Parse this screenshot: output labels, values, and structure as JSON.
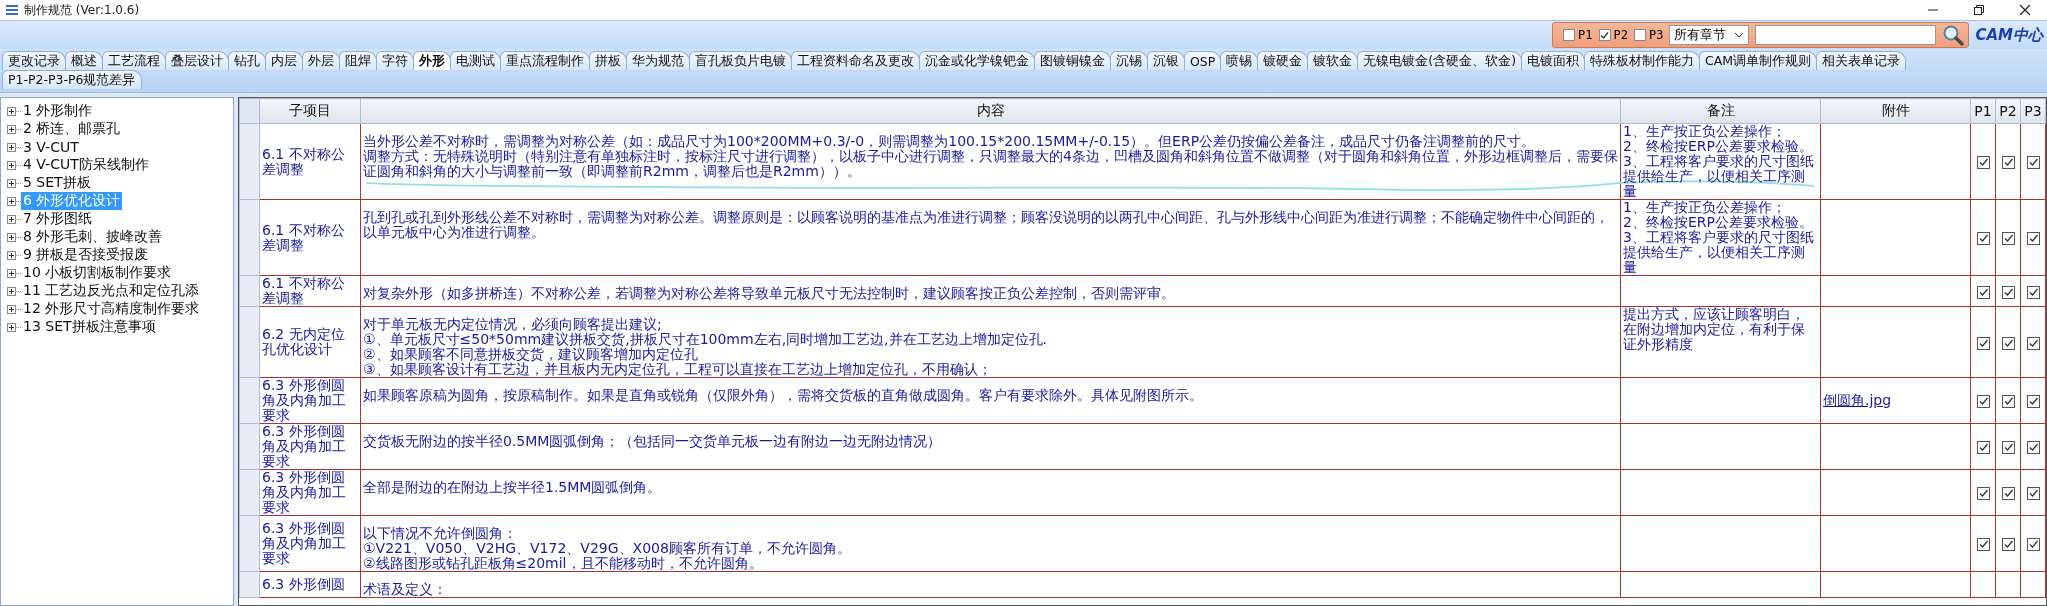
{
  "window": {
    "title": "制作规范 (Ver:1.0.6)"
  },
  "filter": {
    "options": [
      {
        "label": "P1",
        "checked": false
      },
      {
        "label": "P2",
        "checked": true
      },
      {
        "label": "P3",
        "checked": false
      }
    ],
    "chapter": "所有章节",
    "logo": "CAM中心"
  },
  "tab_rows": [
    [
      {
        "label": "更改记录",
        "selected": false
      },
      {
        "label": "概述",
        "selected": false
      },
      {
        "label": "工艺流程",
        "selected": false
      },
      {
        "label": "叠层设计",
        "selected": false
      },
      {
        "label": "钻孔",
        "selected": false
      },
      {
        "label": "内层",
        "selected": false
      },
      {
        "label": "外层",
        "selected": false
      },
      {
        "label": "阻焊",
        "selected": false
      },
      {
        "label": "字符",
        "selected": false
      },
      {
        "label": "外形",
        "selected": true
      },
      {
        "label": "电测试",
        "selected": false
      },
      {
        "label": "重点流程制作",
        "selected": false
      },
      {
        "label": "拼板",
        "selected": false
      },
      {
        "label": "华为规范",
        "selected": false
      },
      {
        "label": "盲孔板负片电镀",
        "selected": false
      },
      {
        "label": "工程资料命名及更改",
        "selected": false
      },
      {
        "label": "沉金或化学镍钯金",
        "selected": false
      },
      {
        "label": "图镀铜镍金",
        "selected": false
      },
      {
        "label": "沉锡",
        "selected": false
      },
      {
        "label": "沉银",
        "selected": false
      },
      {
        "label": "OSP",
        "selected": false
      },
      {
        "label": "喷锡",
        "selected": false
      },
      {
        "label": "镀硬金",
        "selected": false
      },
      {
        "label": "镀软金",
        "selected": false
      },
      {
        "label": "无镍电镀金(含硬金、软金)",
        "selected": false
      },
      {
        "label": "电镀面积",
        "selected": false
      },
      {
        "label": "特殊板材制作能力",
        "selected": false
      },
      {
        "label": "CAM调单制作规则",
        "selected": false
      },
      {
        "label": "相关表单记录",
        "selected": false
      }
    ],
    [
      {
        "label": "P1-P2-P3-P6规范差异",
        "selected": false
      }
    ]
  ],
  "tree": [
    {
      "label": "1 外形制作",
      "selected": false
    },
    {
      "label": "2 桥连、邮票孔",
      "selected": false
    },
    {
      "label": "3 V-CUT",
      "selected": false
    },
    {
      "label": "4 V-CUT防呆线制作",
      "selected": false
    },
    {
      "label": "5 SET拼板",
      "selected": false
    },
    {
      "label": "6 外形优化设计",
      "selected": true
    },
    {
      "label": "7 外形图纸",
      "selected": false
    },
    {
      "label": "8 外形毛刺、披峰改善",
      "selected": false
    },
    {
      "label": "9 拼板是否接受报废",
      "selected": false
    },
    {
      "label": "10 小板切割板制作要求",
      "selected": false
    },
    {
      "label": "11 工艺边反光点和定位孔添",
      "selected": false
    },
    {
      "label": "12 外形尺寸高精度制作要求",
      "selected": false
    },
    {
      "label": "13 SET拼板注意事项",
      "selected": false
    }
  ],
  "table": {
    "columns": [
      "子项目",
      "内容",
      "备注",
      "附件",
      "P1",
      "P2",
      "P3"
    ],
    "rows": [
      {
        "subitem": "6.1 不对称公差调整",
        "content": "当外形公差不对称时，需调整为对称公差（如：成品尺寸为100*200MM+0.3/-0，则需调整为100.15*200.15MM+/-0.15）。但ERP公差仍按偏公差备注，成品尺寸仍备注调整前的尺寸。",
        "content_2": "调整方式：无特殊说明时（特别注意有单独标注时，按标注尺寸进行调整），以板子中心进行调整，只调整最大的4条边，凹槽及圆角和斜角位置不做调整（对于圆角和斜角位置，外形边框调整后，需要保证圆角和斜角的大小与调整前一致（即调整前R2mm，调整后也是R2mm））。",
        "remark": "1、生产按正负公差操作；\n2、终检按ERP公差要求检验。\n3、工程将客户要求的尺寸图纸提供给生产，以便相关工序测量",
        "p1": true,
        "p2": true,
        "p3": true,
        "scribbled": true
      },
      {
        "subitem": "6.1 不对称公差调整",
        "content": "孔到孔或孔到外形线公差不对称时，需调整为对称公差。调整原则是：以顾客说明的基准点为准进行调整；顾客没说明的以两孔中心间距、孔与外形线中心间距为准进行调整；不能确定物件中心间距的，以单元板中心为准进行调整。",
        "remark": "1、生产按正负公差操作；\n2、终检按ERP公差要求检验。\n3、工程将客户要求的尺寸图纸提供给生产，以便相关工序测量",
        "p1": true,
        "p2": true,
        "p3": true
      },
      {
        "subitem": "6.1 不对称公差调整",
        "content": "对复杂外形（如多拼桥连）不对称公差，若调整为对称公差将导致单元板尺寸无法控制时，建议顾客按正负公差控制，否则需评审。",
        "p1": true,
        "p2": true,
        "p3": true
      },
      {
        "subitem": "6.2 无内定位孔优化设计",
        "content": "对于单元板无内定位情况，必须向顾客提出建议;\n①、单元板尺寸≤50*50mm建议拼板交货,拼板尺寸在100mm左右,同时增加工艺边,并在工艺边上增加定位孔.\n②、如果顾客不同意拼板交货，建议顾客增加内定位孔\n③、如果顾客设计有工艺边，并且板内无内定位孔，工程可以直接在工艺边上增加定位孔，不用确认；",
        "remark": "提出方式，应该让顾客明白，在附边增加内定位，有利于保证外形精度",
        "p1": true,
        "p2": true,
        "p3": true
      },
      {
        "subitem": "6.3 外形倒圆角及内角加工要求",
        "content": "如果顾客原稿为圆角，按原稿制作。如果是直角或锐角（仅限外角），需将交货板的直角做成圆角。客户有要求除外。具体见附图所示。",
        "attachment": "倒圆角.jpg",
        "p1": true,
        "p2": true,
        "p3": true
      },
      {
        "subitem": "6.3 外形倒圆角及内角加工要求",
        "content": "交货板无附边的按半径0.5MM圆弧倒角；（包括同一交货单元板一边有附边一边无附边情况）",
        "p1": true,
        "p2": true,
        "p3": true
      },
      {
        "subitem": "6.3 外形倒圆角及内角加工要求",
        "content": "全部是附边的在附边上按半径1.5MM圆弧倒角。",
        "p1": true,
        "p2": true,
        "p3": true
      },
      {
        "subitem": "6.3 外形倒圆角及内角加工要求",
        "content": "以下情况不允许倒圆角：\n①V221、V050、V2HG、V172、V29G、X008顾客所有订单，不允许圆角。\n②线路图形或钻孔距板角≤20mil，且不能移动时，不允许圆角。",
        "p1": true,
        "p2": true,
        "p3": true
      },
      {
        "subitem": "6.3 外形倒圆",
        "content": "术语及定义："
      }
    ]
  }
}
